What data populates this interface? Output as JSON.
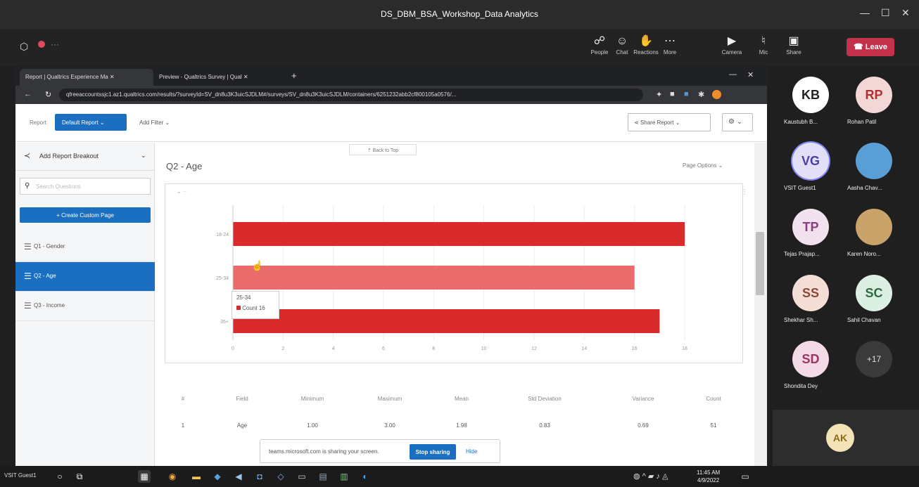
{
  "window": {
    "title": "DS_DBM_BSA_Workshop_Data Analytics"
  },
  "teams_toolbar": {
    "items": [
      {
        "label": "People",
        "icon": "people-icon",
        "glyph": "☍"
      },
      {
        "label": "Chat",
        "icon": "chat-icon",
        "glyph": "☺"
      },
      {
        "label": "Reactions",
        "icon": "reactions-icon",
        "glyph": "✋"
      },
      {
        "label": "More",
        "icon": "more-icon",
        "glyph": "⋯"
      },
      {
        "label": "Camera",
        "icon": "camera-icon",
        "glyph": "▶"
      },
      {
        "label": "Mic",
        "icon": "mic-icon",
        "glyph": "♮"
      },
      {
        "label": "Share",
        "icon": "share-icon",
        "glyph": "▣"
      }
    ],
    "leave_label": "Leave",
    "leave_color": "#c4314b"
  },
  "browser": {
    "tabs": [
      {
        "label": "Report | Qualtrics Experience Ma"
      },
      {
        "label": "Preview - Qualtrics Survey | Qual"
      }
    ],
    "url": "qfreeaccountssjc1.az1.qualtrics.com/results/?surveyId=SV_dn8u3K3uicSJDLM#/surveys/SV_dn8u3K3uicSJDLM/containers/6251232abb2cf800105a0576/..."
  },
  "report": {
    "report_label": "Report",
    "report_dropdown": "Default Report",
    "add_filter": "Add Filter",
    "share_report": "Share Report",
    "back_to_top": "Back to Top",
    "page_title": "Q2 - Age",
    "page_options": "Page Options",
    "breakout": "Add Report Breakout",
    "search_placeholder": "Search Questions",
    "create_custom_page": "Create Custom Page",
    "questions": [
      {
        "label": "Q1 - Gender",
        "active": false
      },
      {
        "label": "Q2 - Age",
        "active": true
      },
      {
        "label": "Q3 - Income",
        "active": false
      }
    ],
    "accent": "#1a6fc1",
    "tooltip": {
      "category": "25-34",
      "label": "Count",
      "value": "16"
    }
  },
  "chart_data": {
    "type": "bar",
    "orientation": "horizontal",
    "categories": [
      "18-24",
      "25-34",
      "35+"
    ],
    "series": [
      {
        "values": [
          18,
          16,
          17
        ]
      }
    ],
    "xlim": [
      0,
      18
    ],
    "xticks": [
      "0",
      "2",
      "4",
      "6",
      "8",
      "10",
      "12",
      "14",
      "16",
      "18"
    ],
    "colors": [
      "#d92b2b",
      "#e96b6b",
      "#d92b2b"
    ],
    "grid": true
  },
  "stats_table": {
    "headers": [
      "#",
      "Field",
      "Minimum",
      "Maximum",
      "Mean",
      "Std Deviation",
      "Variance",
      "Count"
    ],
    "rows": [
      [
        "1",
        "Age",
        "1.00",
        "3.00",
        "1.98",
        "0.83",
        "0.69",
        "51"
      ]
    ]
  },
  "share_popup": {
    "text": "teams.microsoft.com is sharing your screen.",
    "stop": "Stop sharing",
    "hide": "Hide"
  },
  "participants": [
    {
      "initials": "KB",
      "name": "Kaustubh B...",
      "bg": "#ffffff",
      "fg": "#222222",
      "photo": false
    },
    {
      "initials": "RP",
      "name": "Rohan Patil",
      "bg": "#f3d6d6",
      "fg": "#b03030",
      "photo": false
    },
    {
      "initials": "VG",
      "name": "VSIT Guest1",
      "bg": "#e3dff6",
      "fg": "#4a3fa6",
      "photo": false
    },
    {
      "initials": "",
      "name": "Aasha Chav...",
      "bg": "#5a9ed6",
      "fg": "#ffffff",
      "photo": true
    },
    {
      "initials": "TP",
      "name": "Tejas Prajap...",
      "bg": "#f2e1ef",
      "fg": "#8a3f7d",
      "photo": false
    },
    {
      "initials": "",
      "name": "Karen Noro...",
      "bg": "#c9a36a",
      "fg": "#ffffff",
      "photo": true
    },
    {
      "initials": "SS",
      "name": "Shekhar Sh...",
      "bg": "#f5ded6",
      "fg": "#8a4a3a",
      "photo": false
    },
    {
      "initials": "SC",
      "name": "Sahil Chavan",
      "bg": "#dcefe3",
      "fg": "#2e6b45",
      "photo": false
    },
    {
      "initials": "SD",
      "name": "Shondita Dey",
      "bg": "#f4d9e6",
      "fg": "#a03463",
      "photo": false
    },
    {
      "initials": "+17",
      "name": "",
      "bg": "#3a3a3a",
      "fg": "#dddddd",
      "photo": false
    }
  ],
  "self_view": {
    "initials": "AK"
  },
  "taskbar": {
    "user": "VSIT Guest1",
    "time": "11:45 AM",
    "date": "4/9/2022"
  }
}
